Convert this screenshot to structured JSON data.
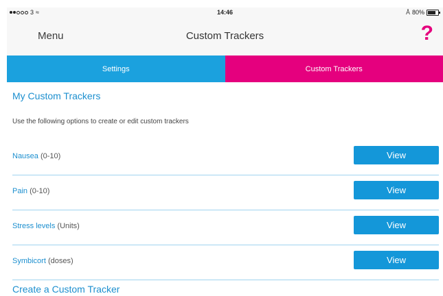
{
  "status_bar": {
    "carrier": "3",
    "time": "14:46",
    "battery": "80%",
    "battery_level": 0.8
  },
  "nav": {
    "menu_label": "Menu",
    "title": "Custom Trackers",
    "help_label": "?"
  },
  "tabs": [
    {
      "label": "Settings",
      "active": false
    },
    {
      "label": "Custom Trackers",
      "active": true
    }
  ],
  "section": {
    "heading": "My Custom Trackers",
    "description": "Use the following options to create or edit custom trackers"
  },
  "trackers": [
    {
      "name": "Nausea",
      "unit": "(0-10)",
      "button": "View"
    },
    {
      "name": "Pain",
      "unit": "(0-10)",
      "button": "View"
    },
    {
      "name": "Stress levels",
      "unit": "(Units)",
      "button": "View"
    },
    {
      "name": "Symbicort",
      "unit": "(doses)",
      "button": "View"
    }
  ],
  "create": {
    "heading": "Create a Custom Tracker"
  },
  "colors": {
    "accent_blue": "#1ba1de",
    "accent_pink": "#e5007e",
    "link_blue": "#1c8fcf"
  }
}
